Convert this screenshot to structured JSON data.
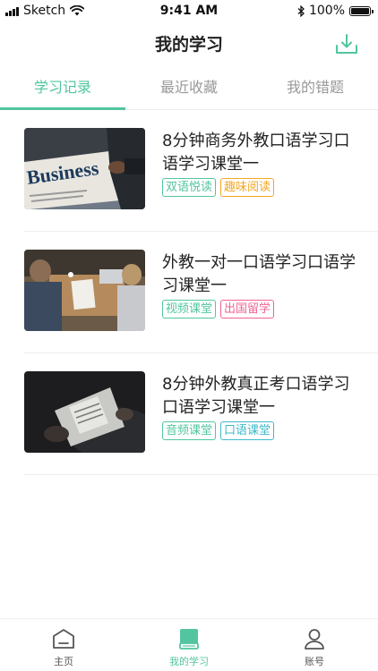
{
  "status_bar": {
    "carrier": "Sketch",
    "time": "9:41 AM",
    "battery": "100%"
  },
  "header": {
    "title": "我的学习",
    "download_icon": "download-icon"
  },
  "tabs": [
    {
      "label": "学习记录",
      "active": true
    },
    {
      "label": "最近收藏",
      "active": false
    },
    {
      "label": "我的错题",
      "active": false
    }
  ],
  "courses": [
    {
      "title": "8分钟商务外教口语学习口语学习课堂一",
      "thumbnail": "business-newspaper-photo",
      "tags": [
        {
          "label": "双语悦读",
          "color": "#52c5a0"
        },
        {
          "label": "趣味阅读",
          "color": "#f5a623"
        }
      ]
    },
    {
      "title": "外教一对一口语学习口语学习课堂一",
      "thumbnail": "meeting-desk-photo",
      "tags": [
        {
          "label": "视频课堂",
          "color": "#52c5a0"
        },
        {
          "label": "出国留学",
          "color": "#f06292"
        }
      ]
    },
    {
      "title": "8分钟外教真正考口语学习口语学习课堂一",
      "thumbnail": "reading-newspaper-photo",
      "tags": [
        {
          "label": "音频课堂",
          "color": "#52c5a0"
        },
        {
          "label": "口语课堂",
          "color": "#3fb9c9"
        }
      ]
    }
  ],
  "tab_bar": [
    {
      "label": "主页",
      "icon": "home-icon",
      "active": false
    },
    {
      "label": "我的学习",
      "icon": "book-icon",
      "active": true
    },
    {
      "label": "账号",
      "icon": "user-icon",
      "active": false
    }
  ],
  "colors": {
    "accent": "#52c5a0",
    "inactive": "#999999"
  }
}
